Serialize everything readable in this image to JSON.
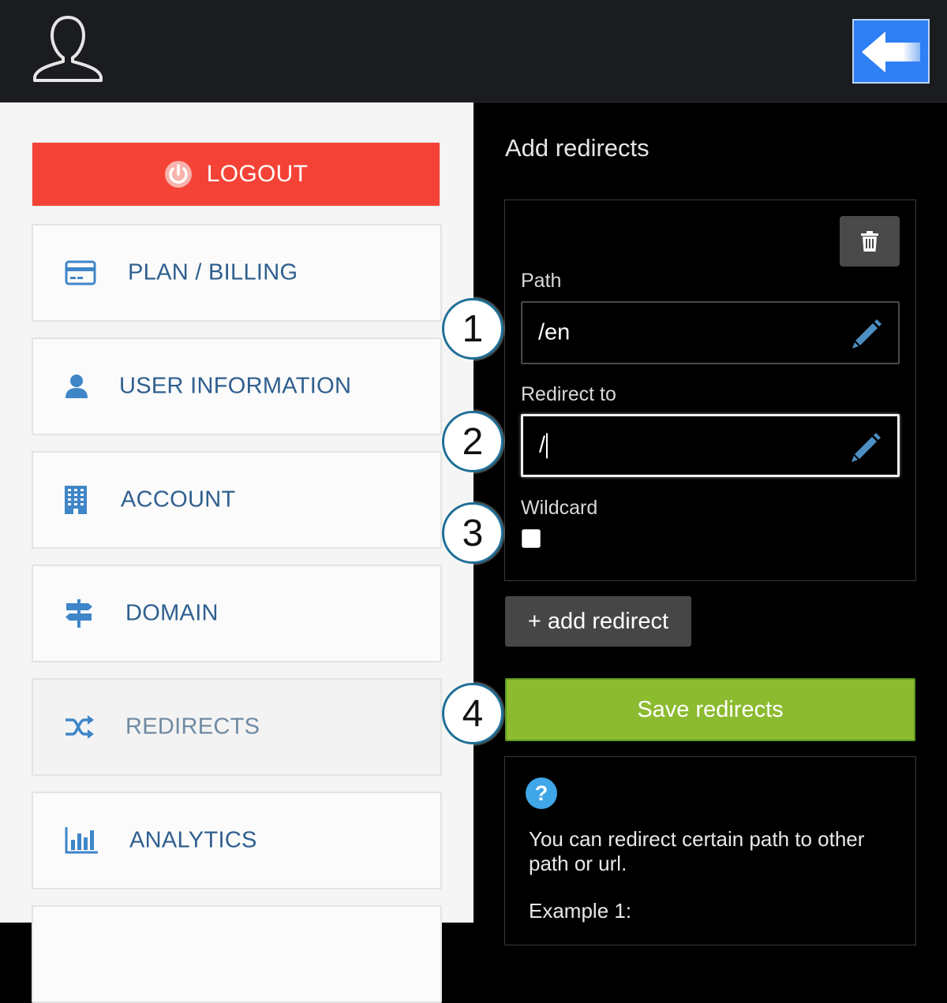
{
  "header": {
    "avatar_icon": "user-outline-icon",
    "back_icon": "arrow-left-icon"
  },
  "sidebar": {
    "logout_label": "LOGOUT",
    "items": [
      {
        "label": "PLAN / BILLING",
        "icon": "credit-card-icon"
      },
      {
        "label": "USER INFORMATION",
        "icon": "user-icon"
      },
      {
        "label": "ACCOUNT",
        "icon": "building-icon"
      },
      {
        "label": "DOMAIN",
        "icon": "signpost-icon"
      },
      {
        "label": "REDIRECTS",
        "icon": "shuffle-icon",
        "active": true
      },
      {
        "label": "ANALYTICS",
        "icon": "bar-chart-icon"
      }
    ]
  },
  "redirects": {
    "title": "Add redirects",
    "path_label": "Path",
    "path_value": "/en",
    "redirect_label": "Redirect to",
    "redirect_value": "/",
    "wildcard_label": "Wildcard",
    "wildcard_checked": false,
    "add_label": "+ add redirect",
    "save_label": "Save redirects"
  },
  "help": {
    "icon": "?",
    "text": "You can redirect certain path to other path or url.",
    "example": "Example 1:"
  },
  "callouts": [
    "1",
    "2",
    "3",
    "4"
  ],
  "colors": {
    "logout": "#f44336",
    "save": "#8cbb30",
    "back": "#2f7ff5",
    "nav_text": "#2f5f8f",
    "help_icon": "#3fa6e8"
  }
}
